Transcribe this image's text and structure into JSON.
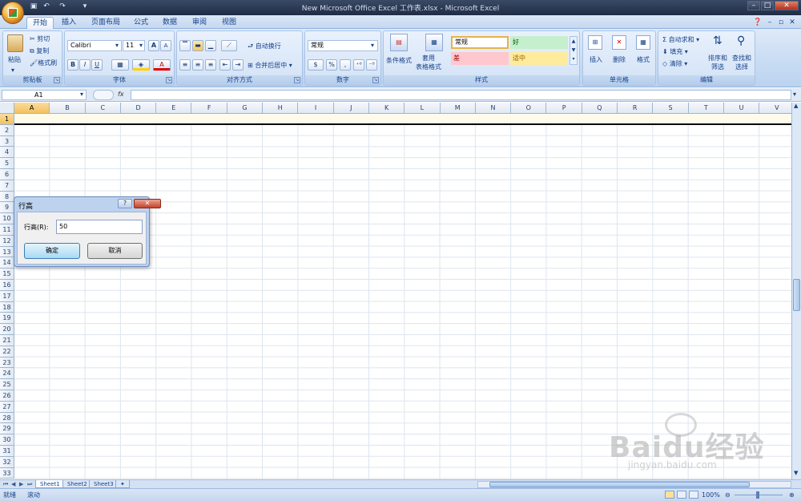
{
  "window": {
    "title": "New Microsoft Office Excel 工作表.xlsx - Microsoft Excel",
    "min": "–",
    "max": "□",
    "close": "✕"
  },
  "tabs": [
    "开始",
    "插入",
    "页面布局",
    "公式",
    "数据",
    "审阅",
    "视图"
  ],
  "clipboard": {
    "paste": "粘贴",
    "cut": "剪切",
    "copy": "复制",
    "format_painter": "格式刷",
    "label": "剪贴板"
  },
  "font": {
    "name": "Calibri",
    "size": "11",
    "bold": "B",
    "italic": "I",
    "underline": "U",
    "grow": "A",
    "shrink": "A",
    "label": "字体"
  },
  "alignment": {
    "wrap": "自动换行",
    "merge": "合并后居中",
    "label": "对齐方式"
  },
  "number": {
    "format": "常规",
    "currency": "$",
    "percent": "%",
    "comma": ",",
    "label": "数字"
  },
  "styles": {
    "conditional": "条件格式",
    "table": "套用\n表格格式",
    "normal": "常规",
    "good": "好",
    "bad": "差",
    "neutral": "适中",
    "label": "样式"
  },
  "cells": {
    "insert": "插入",
    "delete": "删除",
    "format": "格式",
    "label": "单元格"
  },
  "editing": {
    "autosum": "自动求和",
    "fill": "填充",
    "clear": "清除",
    "sort": "排序和\n筛选",
    "find": "查找和\n选择",
    "label": "编辑"
  },
  "namebox": "A1",
  "columns": [
    "A",
    "B",
    "C",
    "D",
    "E",
    "F",
    "G",
    "H",
    "I",
    "J",
    "K",
    "L",
    "M",
    "N",
    "O",
    "P",
    "Q",
    "R",
    "S",
    "T",
    "U",
    "V"
  ],
  "rows": [
    "1",
    "2",
    "3",
    "4",
    "5",
    "6",
    "7",
    "8",
    "9",
    "10",
    "11",
    "12",
    "13",
    "14",
    "15",
    "16",
    "17",
    "18",
    "19",
    "20",
    "21",
    "22",
    "23",
    "24",
    "25",
    "26",
    "27",
    "28",
    "29",
    "30",
    "31",
    "32",
    "33"
  ],
  "sheets": [
    "Sheet1",
    "Sheet2",
    "Sheet3"
  ],
  "status": {
    "ready": "就绪",
    "scroll": "滚动",
    "zoom": "100%"
  },
  "dialog": {
    "title": "行高",
    "help": "?",
    "close": "✕",
    "label": "行高(R):",
    "value": "50",
    "ok": "确定",
    "cancel": "取消"
  },
  "watermark": {
    "brand": "Baidu经验",
    "url": "jingyan.baidu.com"
  }
}
